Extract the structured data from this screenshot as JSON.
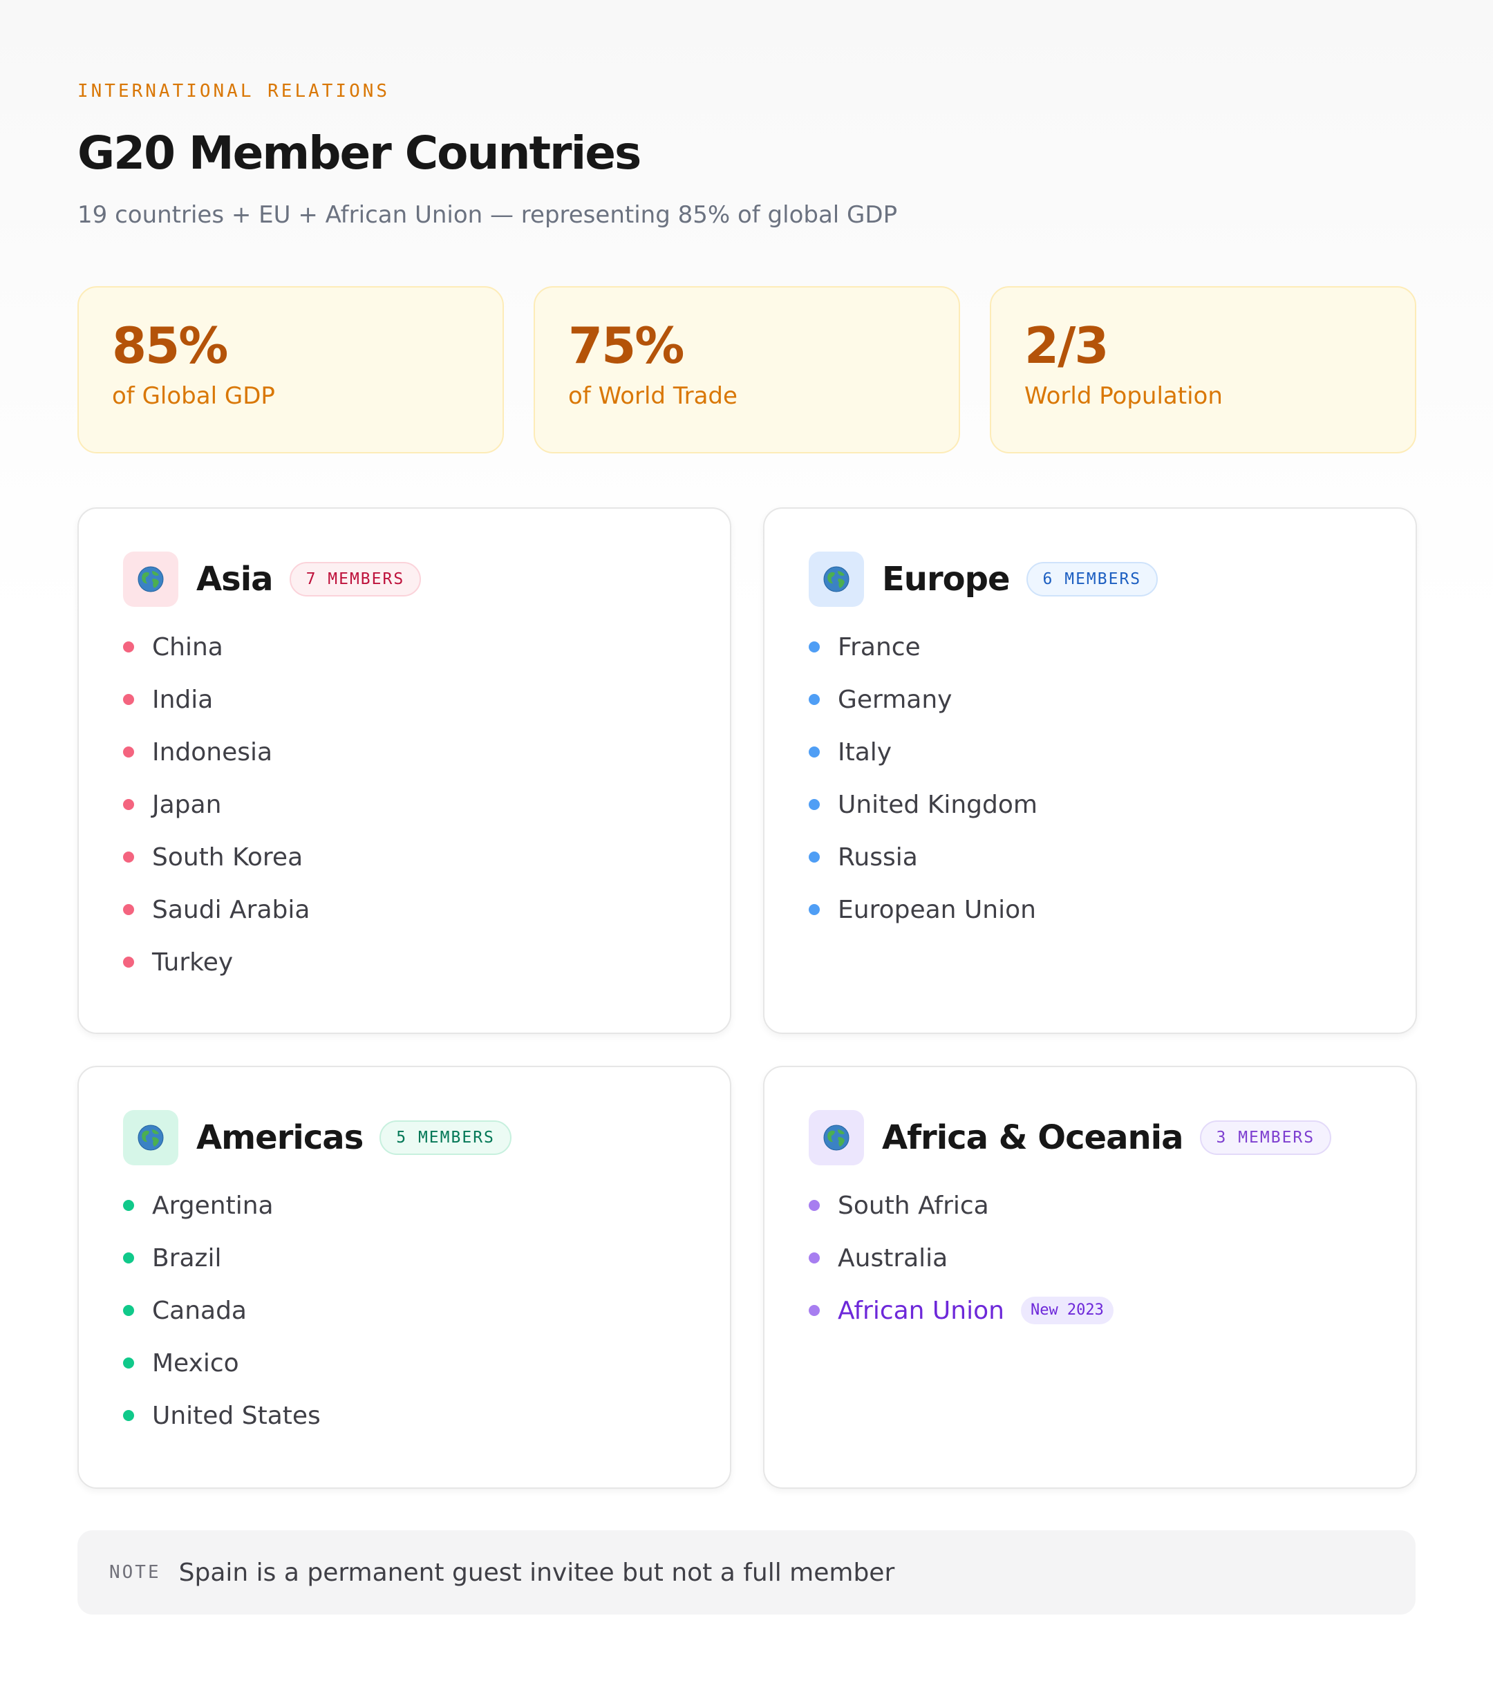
{
  "header": {
    "eyebrow": "INTERNATIONAL RELATIONS",
    "title": "G20 Member Countries",
    "subtitle": "19 countries + EU + African Union — representing 85% of global GDP"
  },
  "stats": [
    {
      "value": "85%",
      "label": "of Global GDP"
    },
    {
      "value": "75%",
      "label": "of World Trade"
    },
    {
      "value": "2/3",
      "label": "World Population"
    }
  ],
  "regions": [
    {
      "name": "Asia",
      "badge": "7 MEMBERS",
      "icon": "globe-icon",
      "accent": "#f4647f",
      "badge_bg": "#fdf0f2",
      "badge_border": "#fbd3da",
      "badge_color": "#be123c",
      "icon_bg": "#fde4e8",
      "members": [
        "China",
        "India",
        "Indonesia",
        "Japan",
        "South Korea",
        "Saudi Arabia",
        "Turkey"
      ]
    },
    {
      "name": "Europe",
      "badge": "6 MEMBERS",
      "icon": "globe-icon",
      "accent": "#4f9ef5",
      "badge_bg": "#eef6ff",
      "badge_border": "#cfe3fb",
      "badge_color": "#1d5fc1",
      "icon_bg": "#dceafd",
      "members": [
        "France",
        "Germany",
        "Italy",
        "United Kingdom",
        "Russia",
        "European Union"
      ]
    },
    {
      "name": "Americas",
      "badge": "5 MEMBERS",
      "icon": "globe-icon",
      "accent": "#10c98a",
      "badge_bg": "#ecfbf4",
      "badge_border": "#c7f0de",
      "badge_color": "#047857",
      "icon_bg": "#d6f6e8",
      "members": [
        "Argentina",
        "Brazil",
        "Canada",
        "Mexico",
        "United States"
      ]
    },
    {
      "name": "Africa & Oceania",
      "badge": "3 MEMBERS",
      "icon": "globe-icon",
      "accent": "#a77ef0",
      "badge_bg": "#f5f2fe",
      "badge_border": "#e3daf9",
      "badge_color": "#7e3fd0",
      "icon_bg": "#ece6fd",
      "members": [
        "South Africa",
        "Australia"
      ],
      "highlight": {
        "name": "African Union",
        "tag": "New 2023",
        "color": "#6d28d9"
      }
    }
  ],
  "note": {
    "label": "NOTE",
    "text": "Spain is a permanent guest invitee but not a full member"
  }
}
